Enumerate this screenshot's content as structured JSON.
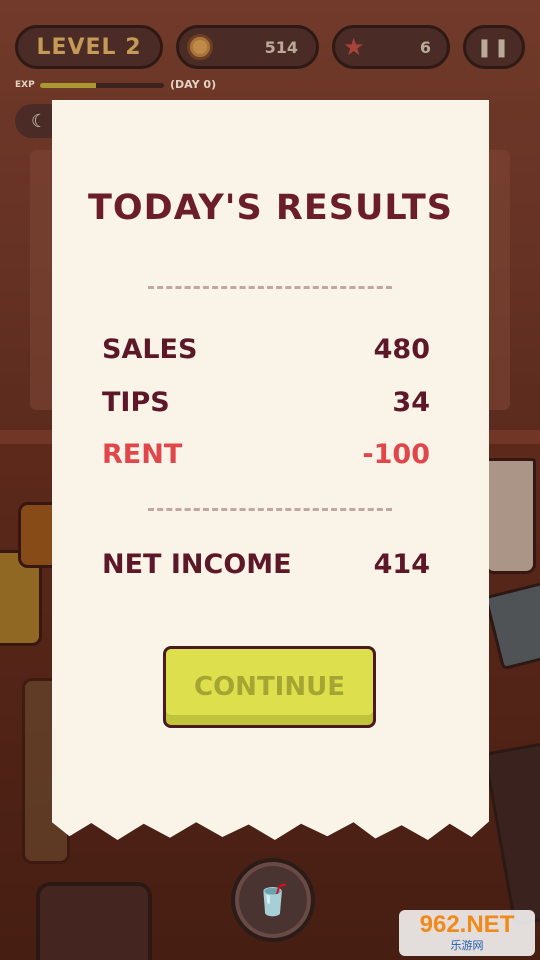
{
  "hud": {
    "level_label": "LEVEL 2",
    "coins": "514",
    "stars": "6",
    "exp_label": "EXP",
    "exp_progress": 0.45,
    "day_label": "(DAY 0)",
    "icons": {
      "coin": "coin-icon",
      "star": "star-icon",
      "pause": "pause-icon",
      "moon": "moon-icon"
    }
  },
  "results": {
    "title": "TODAY'S RESULTS",
    "rows": [
      {
        "label": "SALES",
        "value": "480"
      },
      {
        "label": "TIPS",
        "value": "34"
      },
      {
        "label": "RENT",
        "value": "-100"
      }
    ],
    "net_income": {
      "label": "NET INCOME",
      "value": "414"
    },
    "continue_label": "CONTINUE"
  },
  "watermark": {
    "brand": "962.NET",
    "sub": "乐游网"
  },
  "colors": {
    "title": "#6b1d2a",
    "text": "#5c1728",
    "negative": "#e0464a",
    "button": "#dde04c",
    "paper": "#f9f3e8"
  }
}
